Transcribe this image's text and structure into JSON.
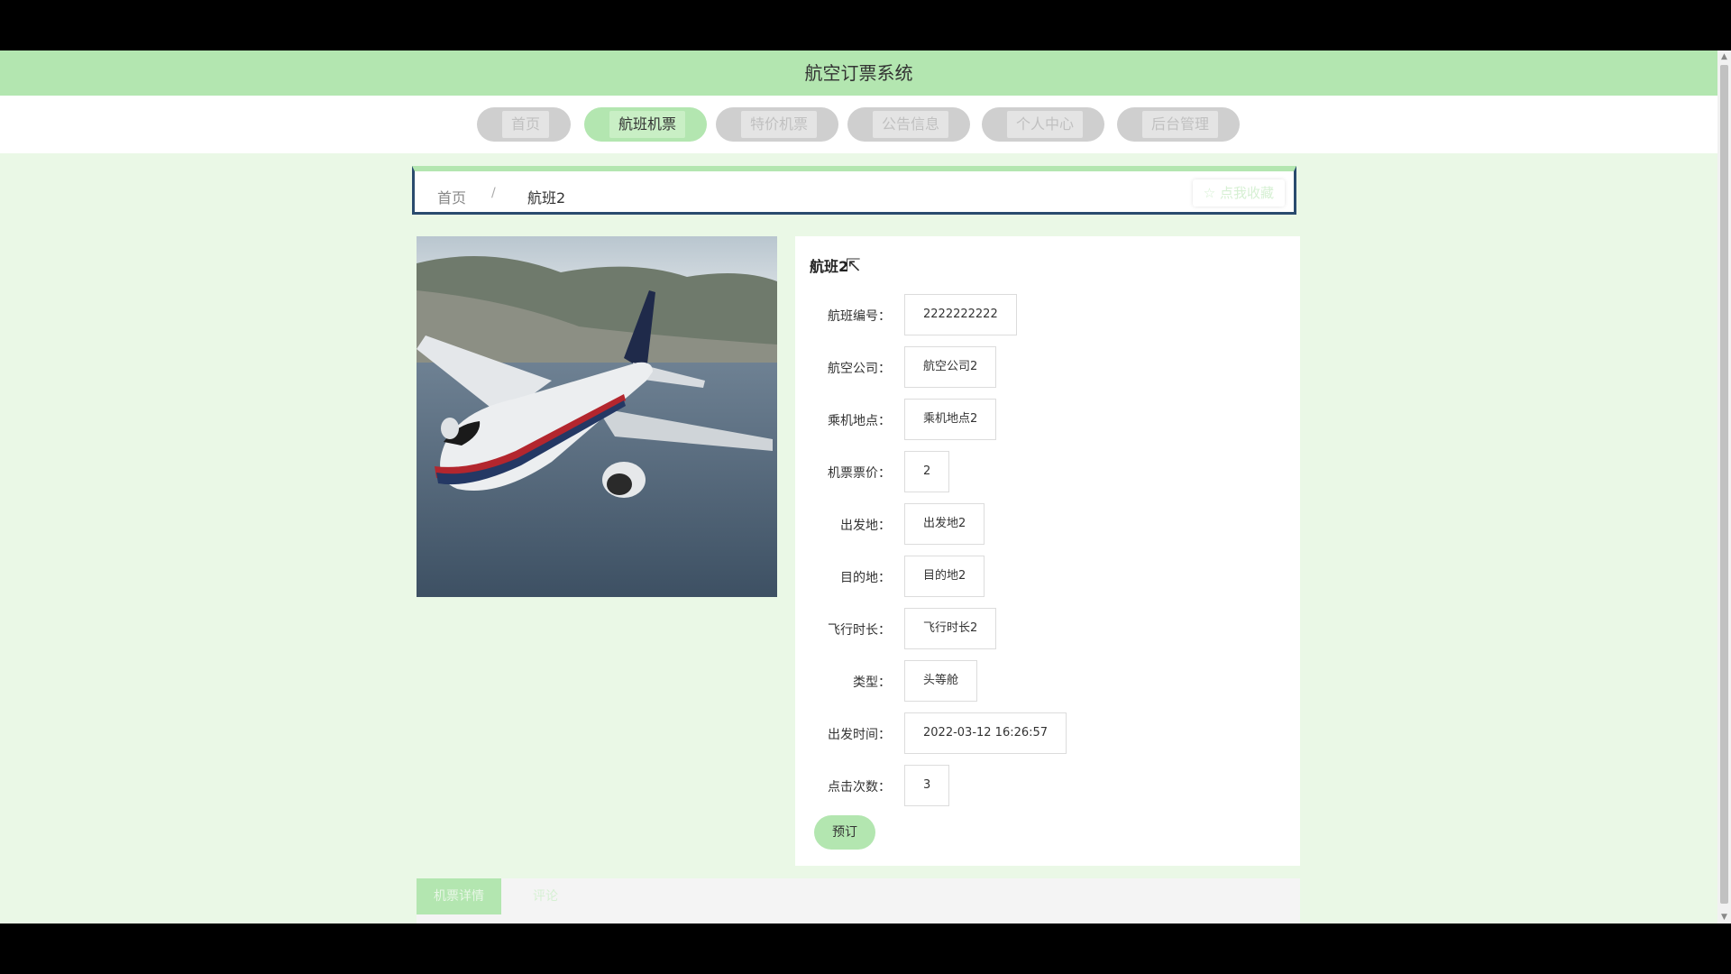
{
  "header": {
    "title": "航空订票系统"
  },
  "nav": {
    "items": [
      {
        "label": "首页",
        "active": false
      },
      {
        "label": "航班机票",
        "active": true
      },
      {
        "label": "特价机票",
        "active": false
      },
      {
        "label": "公告信息",
        "active": false
      },
      {
        "label": "个人中心",
        "active": false
      },
      {
        "label": "后台管理",
        "active": false
      }
    ]
  },
  "breadcrumb": {
    "home": "首页",
    "separator": "/",
    "current": "航班2"
  },
  "favorite_button": {
    "icon": "star-outline-icon",
    "label": "点我收藏"
  },
  "detail": {
    "title": "航班2",
    "fields": [
      {
        "label": "航班编号：",
        "value": "2222222222"
      },
      {
        "label": "航空公司：",
        "value": "航空公司2"
      },
      {
        "label": "乘机地点：",
        "value": "乘机地点2"
      },
      {
        "label": "机票票价：",
        "value": "2"
      },
      {
        "label": "出发地：",
        "value": "出发地2"
      },
      {
        "label": "目的地：",
        "value": "目的地2"
      },
      {
        "label": "飞行时长：",
        "value": "飞行时长2"
      },
      {
        "label": "类型：",
        "value": "头等舱"
      },
      {
        "label": "出发时间：",
        "value": "2022-03-12 16:26:57"
      },
      {
        "label": "点击次数：",
        "value": "3"
      }
    ],
    "book_label": "预订"
  },
  "tabs": [
    {
      "label": "机票详情",
      "active": true
    },
    {
      "label": "评论",
      "active": false
    }
  ],
  "colors": {
    "accent": "#b3e6b0",
    "page_bg": "#eaf8e6",
    "frame": "#000000"
  }
}
